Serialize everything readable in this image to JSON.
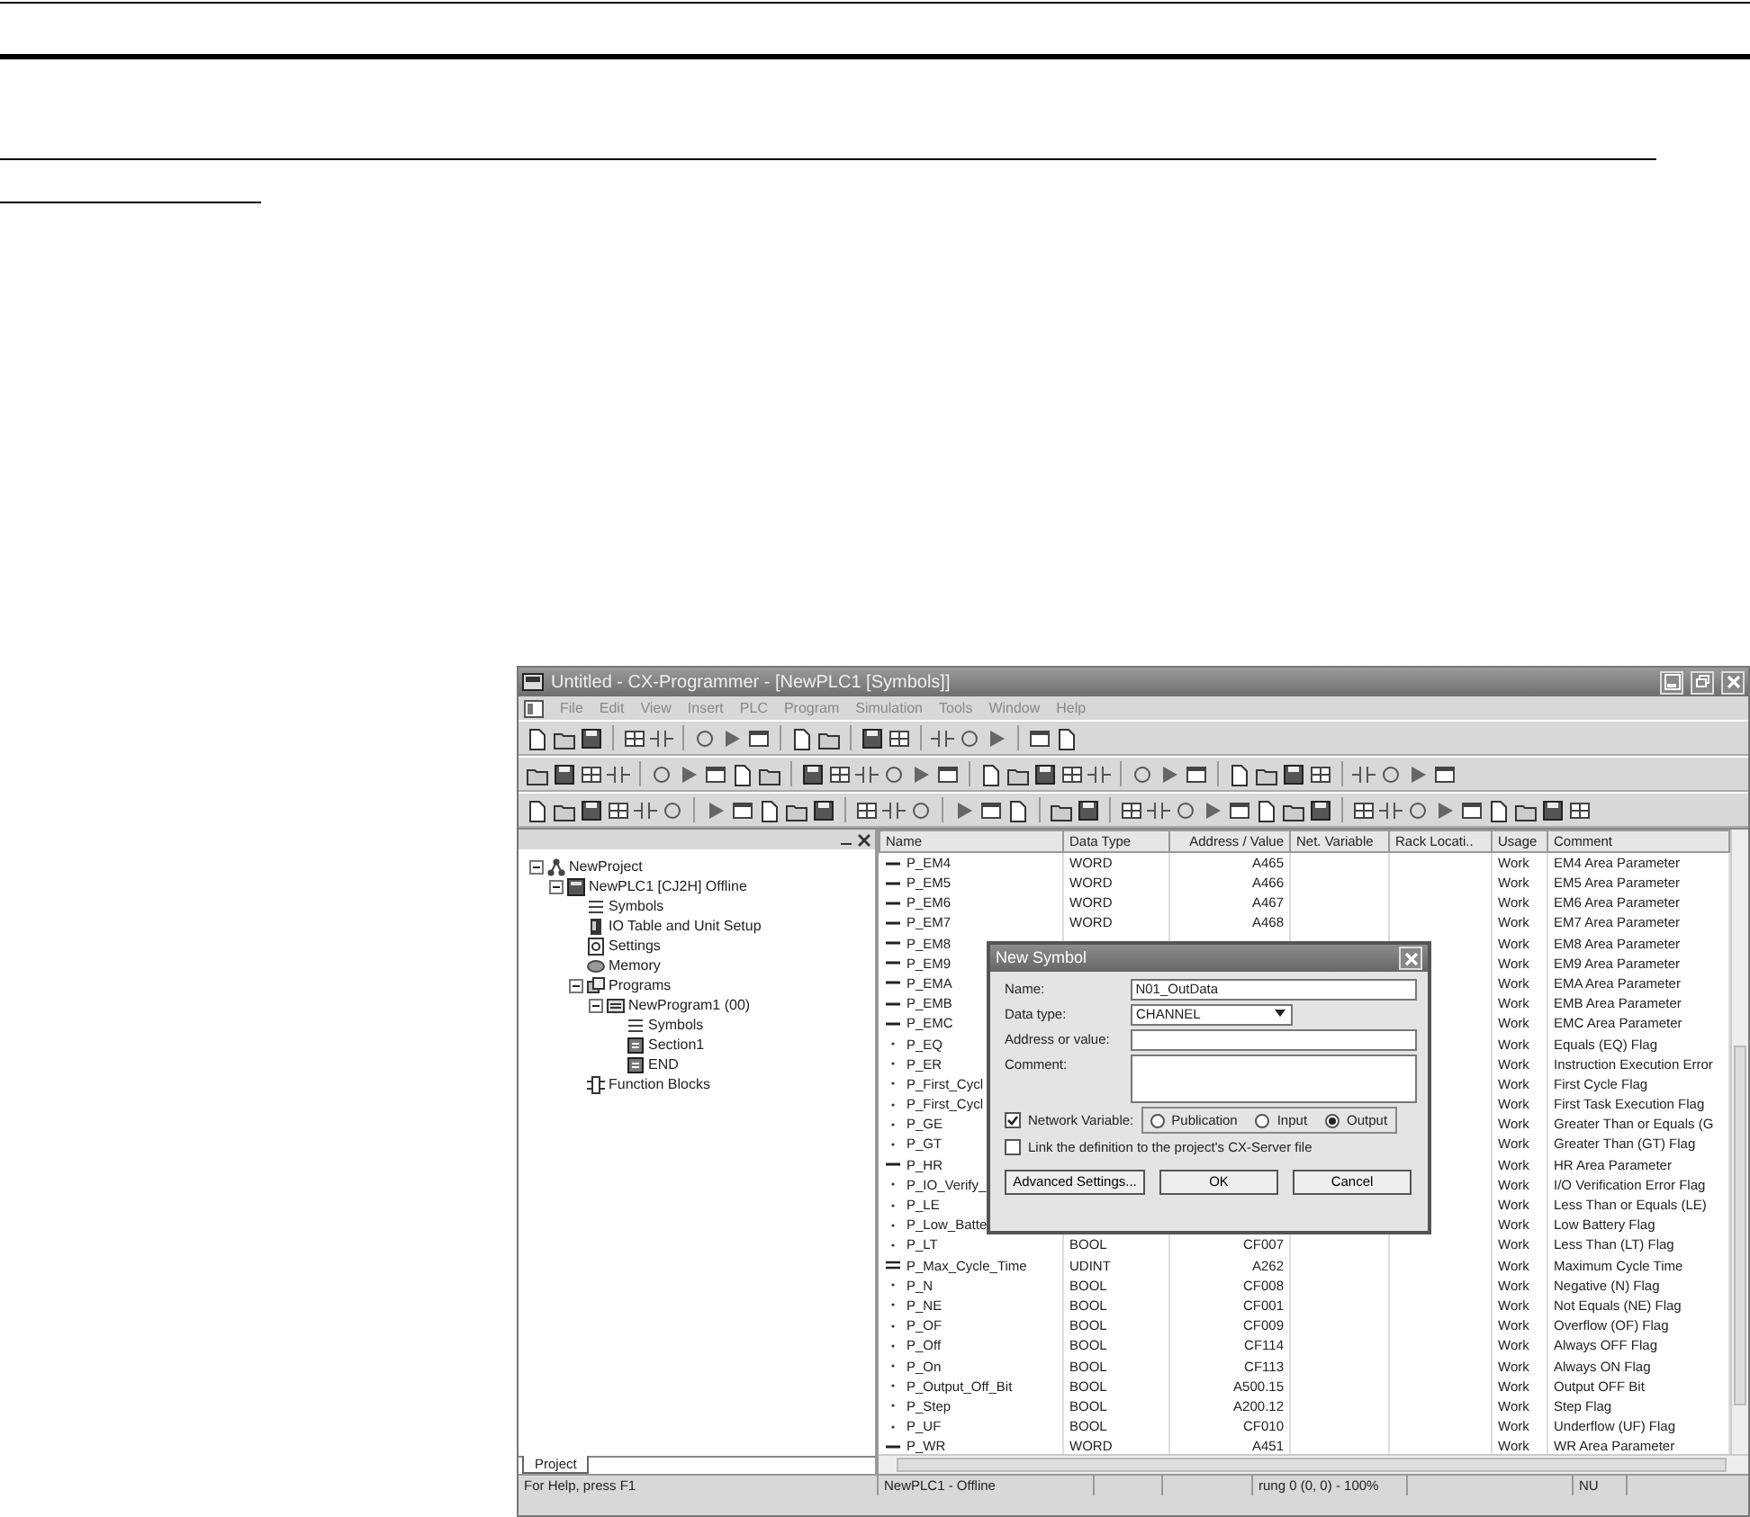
{
  "window": {
    "title": "Untitled - CX-Programmer - [NewPLC1 [Symbols]]"
  },
  "menu": [
    "File",
    "Edit",
    "View",
    "Insert",
    "PLC",
    "Program",
    "Simulation",
    "Tools",
    "Window",
    "Help"
  ],
  "tree": [
    {
      "label": "NewProject",
      "kind": "project",
      "expanded": true,
      "children": [
        {
          "label": "NewPLC1 [CJ2H] Offline",
          "kind": "plc",
          "expanded": true,
          "children": [
            {
              "label": "Symbols",
              "kind": "symbols"
            },
            {
              "label": "IO Table and Unit Setup",
              "kind": "io"
            },
            {
              "label": "Settings",
              "kind": "settings"
            },
            {
              "label": "Memory",
              "kind": "memory"
            },
            {
              "label": "Programs",
              "kind": "programs",
              "expanded": true,
              "children": [
                {
                  "label": "NewProgram1 (00)",
                  "kind": "program",
                  "expanded": true,
                  "children": [
                    {
                      "label": "Symbols",
                      "kind": "symbols"
                    },
                    {
                      "label": "Section1",
                      "kind": "section"
                    },
                    {
                      "label": "END",
                      "kind": "section"
                    }
                  ]
                }
              ]
            },
            {
              "label": "Function Blocks",
              "kind": "blocks"
            }
          ]
        }
      ]
    }
  ],
  "project_tab": "Project",
  "table": {
    "columns": [
      "Name",
      "Data Type",
      "Address / Value",
      "Net. Variable",
      "Rack Locati..",
      "Usage",
      "Comment"
    ],
    "rows": [
      {
        "kind": "word",
        "name": "P_EM4",
        "data_type": "WORD",
        "address": "A465",
        "usage": "Work",
        "comment": "EM4 Area Parameter"
      },
      {
        "kind": "word",
        "name": "P_EM5",
        "data_type": "WORD",
        "address": "A466",
        "usage": "Work",
        "comment": "EM5 Area Parameter"
      },
      {
        "kind": "word",
        "name": "P_EM6",
        "data_type": "WORD",
        "address": "A467",
        "usage": "Work",
        "comment": "EM6 Area Parameter"
      },
      {
        "kind": "word",
        "name": "P_EM7",
        "data_type": "WORD",
        "address": "A468",
        "usage": "Work",
        "comment": "EM7 Area Parameter"
      },
      {
        "kind": "word",
        "name": "P_EM8",
        "usage": "Work",
        "comment": "EM8 Area Parameter"
      },
      {
        "kind": "word",
        "name": "P_EM9",
        "usage": "Work",
        "comment": "EM9 Area Parameter"
      },
      {
        "kind": "word",
        "name": "P_EMA",
        "usage": "Work",
        "comment": "EMA Area Parameter"
      },
      {
        "kind": "word",
        "name": "P_EMB",
        "usage": "Work",
        "comment": "EMB Area Parameter"
      },
      {
        "kind": "word",
        "name": "P_EMC",
        "usage": "Work",
        "comment": "EMC Area Parameter"
      },
      {
        "kind": "bool",
        "name": "P_EQ",
        "usage": "Work",
        "comment": "Equals (EQ) Flag"
      },
      {
        "kind": "bool",
        "name": "P_ER",
        "usage": "Work",
        "comment": "Instruction Execution Error"
      },
      {
        "kind": "bool",
        "name": "P_First_Cycl",
        "usage": "Work",
        "comment": "First Cycle Flag"
      },
      {
        "kind": "bool",
        "name": "P_First_Cycl",
        "usage": "Work",
        "comment": "First Task Execution Flag"
      },
      {
        "kind": "bool",
        "name": "P_GE",
        "usage": "Work",
        "comment": "Greater Than or Equals (G"
      },
      {
        "kind": "bool",
        "name": "P_GT",
        "usage": "Work",
        "comment": "Greater Than (GT) Flag"
      },
      {
        "kind": "word",
        "name": "P_HR",
        "usage": "Work",
        "comment": "HR Area Parameter"
      },
      {
        "kind": "bool",
        "name": "P_IO_Verify_",
        "usage": "Work",
        "comment": "I/O Verification Error Flag"
      },
      {
        "kind": "bool",
        "name": "P_LE",
        "usage": "Work",
        "comment": "Less Than or Equals (LE)"
      },
      {
        "kind": "bool",
        "name": "P_Low_Batte",
        "usage": "Work",
        "comment": "Low Battery Flag"
      },
      {
        "kind": "bool",
        "name": "P_LT",
        "data_type": "BOOL",
        "address": "CF007",
        "usage": "Work",
        "comment": "Less Than (LT) Flag"
      },
      {
        "kind": "dword",
        "name": "P_Max_Cycle_Time",
        "data_type": "UDINT",
        "address": "A262",
        "usage": "Work",
        "comment": "Maximum Cycle Time"
      },
      {
        "kind": "bool",
        "name": "P_N",
        "data_type": "BOOL",
        "address": "CF008",
        "usage": "Work",
        "comment": "Negative (N) Flag"
      },
      {
        "kind": "bool",
        "name": "P_NE",
        "data_type": "BOOL",
        "address": "CF001",
        "usage": "Work",
        "comment": "Not Equals (NE) Flag"
      },
      {
        "kind": "bool",
        "name": "P_OF",
        "data_type": "BOOL",
        "address": "CF009",
        "usage": "Work",
        "comment": "Overflow (OF) Flag"
      },
      {
        "kind": "bool",
        "name": "P_Off",
        "data_type": "BOOL",
        "address": "CF114",
        "usage": "Work",
        "comment": "Always OFF Flag"
      },
      {
        "kind": "bool",
        "name": "P_On",
        "data_type": "BOOL",
        "address": "CF113",
        "usage": "Work",
        "comment": "Always ON Flag"
      },
      {
        "kind": "bool",
        "name": "P_Output_Off_Bit",
        "data_type": "BOOL",
        "address": "A500.15",
        "usage": "Work",
        "comment": "Output OFF Bit"
      },
      {
        "kind": "bool",
        "name": "P_Step",
        "data_type": "BOOL",
        "address": "A200.12",
        "usage": "Work",
        "comment": "Step Flag"
      },
      {
        "kind": "bool",
        "name": "P_UF",
        "data_type": "BOOL",
        "address": "CF010",
        "usage": "Work",
        "comment": "Underflow (UF) Flag"
      },
      {
        "kind": "word",
        "name": "P_WR",
        "data_type": "WORD",
        "address": "A451",
        "usage": "Work",
        "comment": "WR Area Parameter"
      }
    ]
  },
  "dialog": {
    "title": "New Symbol",
    "fields": [
      {
        "label": "Name:",
        "kind": "text",
        "value": "N01_OutData"
      },
      {
        "label": "Data type:",
        "kind": "select",
        "value": "CHANNEL"
      },
      {
        "label": "Address or value:",
        "kind": "text"
      },
      {
        "label": "Comment:",
        "kind": "textarea"
      }
    ],
    "network_variable": {
      "label": "Network Variable:",
      "checked": true,
      "options": [
        {
          "label": "Publication",
          "selected": false
        },
        {
          "label": "Input",
          "selected": false
        },
        {
          "label": "Output",
          "selected": true
        }
      ]
    },
    "link": {
      "label": "Link the definition to the project's CX-Server file",
      "checked": false
    },
    "buttons": [
      "Advanced Settings...",
      "OK",
      "Cancel"
    ]
  },
  "status_bar": [
    "For Help, press F1",
    "NewPLC1 - Offline",
    "rung 0 (0, 0)  - 100%",
    "NU"
  ]
}
